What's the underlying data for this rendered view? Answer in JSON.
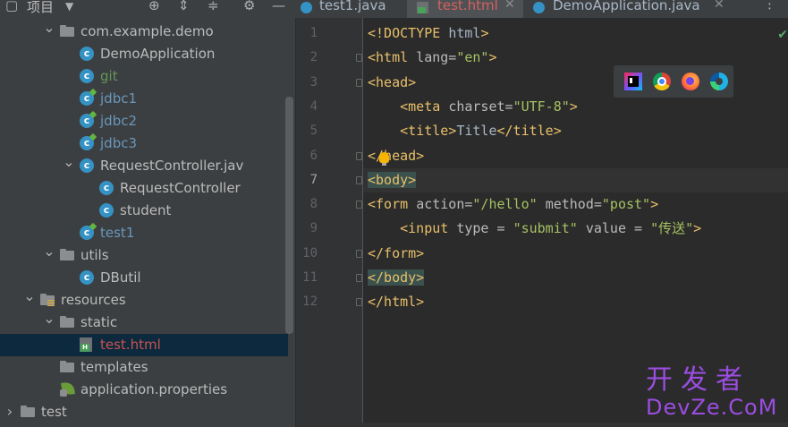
{
  "project_panel": {
    "title": "项目",
    "tree": [
      {
        "label": "com.example.demo",
        "type": "package",
        "expanded": true,
        "color": "default"
      },
      {
        "label": "DemoApplication",
        "type": "class",
        "color": "default"
      },
      {
        "label": "git",
        "type": "class",
        "color": "green"
      },
      {
        "label": "jdbc1",
        "type": "class",
        "color": "blue"
      },
      {
        "label": "jdbc2",
        "type": "class",
        "color": "blue"
      },
      {
        "label": "jdbc3",
        "type": "class",
        "color": "blue"
      },
      {
        "label": "RequestController.jav",
        "type": "class",
        "expanded": true,
        "color": "default"
      },
      {
        "label": "RequestController",
        "type": "class",
        "color": "default"
      },
      {
        "label": "student",
        "type": "class",
        "color": "default"
      },
      {
        "label": "test1",
        "type": "class",
        "color": "blue"
      },
      {
        "label": "utils",
        "type": "package",
        "expanded": true,
        "color": "default"
      },
      {
        "label": "DButil",
        "type": "class",
        "color": "default"
      },
      {
        "label": "resources",
        "type": "resources-folder",
        "expanded": true,
        "color": "default"
      },
      {
        "label": "static",
        "type": "folder",
        "expanded": true,
        "color": "default"
      },
      {
        "label": "test.html",
        "type": "html",
        "color": "red",
        "selected": true
      },
      {
        "label": "templates",
        "type": "folder",
        "color": "default"
      },
      {
        "label": "application.properties",
        "type": "spring",
        "color": "default"
      },
      {
        "label": "test",
        "type": "folder",
        "expanded": false,
        "color": "default"
      }
    ]
  },
  "tabs": [
    {
      "label": "test1.java",
      "icon": "class-icon",
      "active": false
    },
    {
      "label": "test.html",
      "icon": "html-file-icon",
      "active": true
    },
    {
      "label": "DemoApplication.java",
      "icon": "class-icon",
      "active": false
    }
  ],
  "editor": {
    "current_line": 7,
    "line_numbers": [
      "1",
      "2",
      "3",
      "4",
      "5",
      "6",
      "7",
      "8",
      "9",
      "10",
      "11",
      "12"
    ],
    "browsers": [
      "intellij-icon",
      "chrome-icon",
      "firefox-icon",
      "edge-icon"
    ],
    "lines": [
      {
        "ln": "1",
        "tokens": [
          [
            "tg",
            "<!DOCTYPE "
          ],
          [
            "tx",
            "html"
          ],
          [
            "tg",
            ">"
          ]
        ]
      },
      {
        "ln": "2",
        "tokens": [
          [
            "tg",
            "<html "
          ],
          [
            "at",
            "lang="
          ],
          [
            "st",
            "\"en\""
          ],
          [
            "tg",
            ">"
          ]
        ]
      },
      {
        "ln": "3",
        "tokens": [
          [
            "tg",
            "<head>"
          ]
        ]
      },
      {
        "ln": "4",
        "tokens": [
          [
            "tx",
            "    "
          ],
          [
            "tg",
            "<meta "
          ],
          [
            "at",
            "charset="
          ],
          [
            "st",
            "\"UTF-8\""
          ],
          [
            "tg",
            ">"
          ]
        ]
      },
      {
        "ln": "5",
        "tokens": [
          [
            "tx",
            "    "
          ],
          [
            "tg",
            "<title>"
          ],
          [
            "tx",
            "Title"
          ],
          [
            "tg",
            "</title>"
          ]
        ]
      },
      {
        "ln": "6",
        "tokens": [
          [
            "tg",
            "</head>"
          ]
        ]
      },
      {
        "ln": "7",
        "tokens": [
          [
            "tg hl",
            "<body>"
          ]
        ]
      },
      {
        "ln": "8",
        "tokens": [
          [
            "tg",
            "<form "
          ],
          [
            "at",
            "action="
          ],
          [
            "st",
            "\"/hello\" "
          ],
          [
            "at",
            "method="
          ],
          [
            "st",
            "\"post\""
          ],
          [
            "tg",
            ">"
          ]
        ]
      },
      {
        "ln": "9",
        "tokens": [
          [
            "tx",
            "    "
          ],
          [
            "tg",
            "<input "
          ],
          [
            "at",
            "type = "
          ],
          [
            "st",
            "\"submit\" "
          ],
          [
            "at",
            "value = "
          ],
          [
            "st",
            "\"传送\""
          ],
          [
            "tg",
            ">"
          ]
        ]
      },
      {
        "ln": "10",
        "tokens": [
          [
            "tg",
            "</form>"
          ]
        ]
      },
      {
        "ln": "11",
        "tokens": [
          [
            "tg hl",
            "</body>"
          ]
        ]
      },
      {
        "ln": "12",
        "tokens": [
          [
            "tg",
            "</html>"
          ]
        ]
      }
    ]
  },
  "watermark": {
    "cn": "开发者",
    "en": "DevZe.CoM"
  }
}
